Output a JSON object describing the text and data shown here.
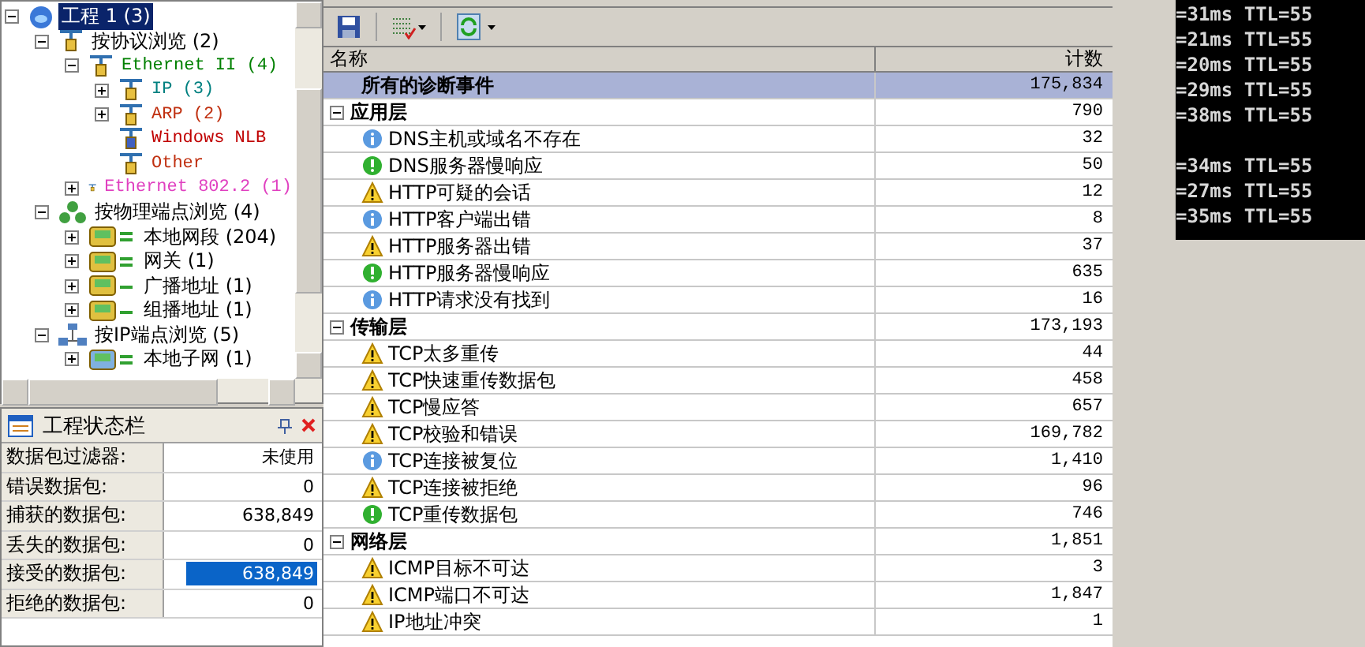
{
  "tree": [
    {
      "label": "工程 1 (3)",
      "kind": "project",
      "selected": true,
      "expanded": true,
      "children": [
        {
          "label": "按协议浏览 (2)",
          "kind": "protocol",
          "selected": false,
          "expanded": true,
          "children": [
            {
              "label": "Ethernet II (4)",
              "kind": "protocol",
              "color": "#008000",
              "selected": false,
              "expanded": true,
              "children": [
                {
                  "label": "IP (3)",
                  "kind": "protocol",
                  "color": "#008080",
                  "selected": false,
                  "expanded": false
                },
                {
                  "label": "ARP (2)",
                  "kind": "protocol",
                  "color": "#c03010",
                  "selected": false,
                  "expanded": false
                },
                {
                  "label": "Windows NLB",
                  "kind": "protocol-blue",
                  "color": "#c00000",
                  "selected": false
                },
                {
                  "label": "Other",
                  "kind": "protocol",
                  "color": "#c03010",
                  "selected": false
                }
              ]
            },
            {
              "label": "Ethernet 802.2 (1)",
              "kind": "protocol",
              "color": "#e040c0",
              "selected": false,
              "expanded": false
            }
          ]
        },
        {
          "label": "按物理端点浏览 (4)",
          "kind": "hosts",
          "selected": false,
          "expanded": true,
          "children": [
            {
              "label": "本地网段 (204)",
              "kind": "segment",
              "selected": false,
              "expanded": false
            },
            {
              "label": "网关 (1)",
              "kind": "segment",
              "selected": false,
              "expanded": false
            },
            {
              "label": "广播地址 (1)",
              "kind": "segment-one",
              "selected": false,
              "expanded": false
            },
            {
              "label": "组播地址 (1)",
              "kind": "segment-one",
              "selected": false,
              "expanded": false
            }
          ]
        },
        {
          "label": "按IP端点浏览 (5)",
          "kind": "network",
          "selected": false,
          "expanded": true,
          "children": [
            {
              "label": "本地子网 (1)",
              "kind": "subnet",
              "selected": false,
              "expanded": false
            }
          ]
        }
      ]
    }
  ],
  "status_panel": {
    "title": "工程状态栏",
    "rows": [
      {
        "label": "数据包过滤器:",
        "value": "未使用",
        "selected": false
      },
      {
        "label": "错误数据包:",
        "value": "0",
        "selected": false
      },
      {
        "label": "捕获的数据包:",
        "value": "638,849",
        "selected": false
      },
      {
        "label": "丢失的数据包:",
        "value": "0",
        "selected": false
      },
      {
        "label": "接受的数据包:",
        "value": "638,849",
        "selected": true
      },
      {
        "label": "拒绝的数据包:",
        "value": "0",
        "selected": false
      }
    ]
  },
  "table": {
    "columns": [
      "名称",
      "计数"
    ],
    "total": {
      "name": "所有的诊断事件",
      "count": "175,834",
      "selected": true
    },
    "groups": [
      {
        "name": "应用层",
        "count": "790",
        "expanded": true,
        "events": [
          {
            "name": "DNS主机或域名不存在",
            "count": "32",
            "kind": "info"
          },
          {
            "name": "DNS服务器慢响应",
            "count": "50",
            "kind": "ok"
          },
          {
            "name": "HTTP可疑的会话",
            "count": "12",
            "kind": "warning"
          },
          {
            "name": "HTTP客户端出错",
            "count": "8",
            "kind": "info"
          },
          {
            "name": "HTTP服务器出错",
            "count": "37",
            "kind": "warning"
          },
          {
            "name": "HTTP服务器慢响应",
            "count": "635",
            "kind": "ok"
          },
          {
            "name": "HTTP请求没有找到",
            "count": "16",
            "kind": "info"
          }
        ]
      },
      {
        "name": "传输层",
        "count": "173,193",
        "expanded": true,
        "events": [
          {
            "name": "TCP太多重传",
            "count": "44",
            "kind": "warning"
          },
          {
            "name": "TCP快速重传数据包",
            "count": "458",
            "kind": "warning"
          },
          {
            "name": "TCP慢应答",
            "count": "657",
            "kind": "warning"
          },
          {
            "name": "TCP校验和错误",
            "count": "169,782",
            "kind": "warning"
          },
          {
            "name": "TCP连接被复位",
            "count": "1,410",
            "kind": "info"
          },
          {
            "name": "TCP连接被拒绝",
            "count": "96",
            "kind": "warning"
          },
          {
            "name": "TCP重传数据包",
            "count": "746",
            "kind": "ok"
          }
        ]
      },
      {
        "name": "网络层",
        "count": "1,851",
        "expanded": true,
        "events": [
          {
            "name": "ICMP目标不可达",
            "count": "3",
            "kind": "warning"
          },
          {
            "name": "ICMP端口不可达",
            "count": "1,847",
            "kind": "warning"
          },
          {
            "name": "IP地址冲突",
            "count": "1",
            "kind": "warning"
          }
        ]
      }
    ]
  },
  "terminal": {
    "blocks": [
      [
        "=31ms TTL=55",
        "=21ms TTL=55",
        "=20ms TTL=55",
        "=29ms TTL=55",
        "=38ms TTL=55"
      ],
      [
        "=34ms TTL=55",
        "=27ms TTL=55",
        "=35ms TTL=55"
      ]
    ]
  }
}
